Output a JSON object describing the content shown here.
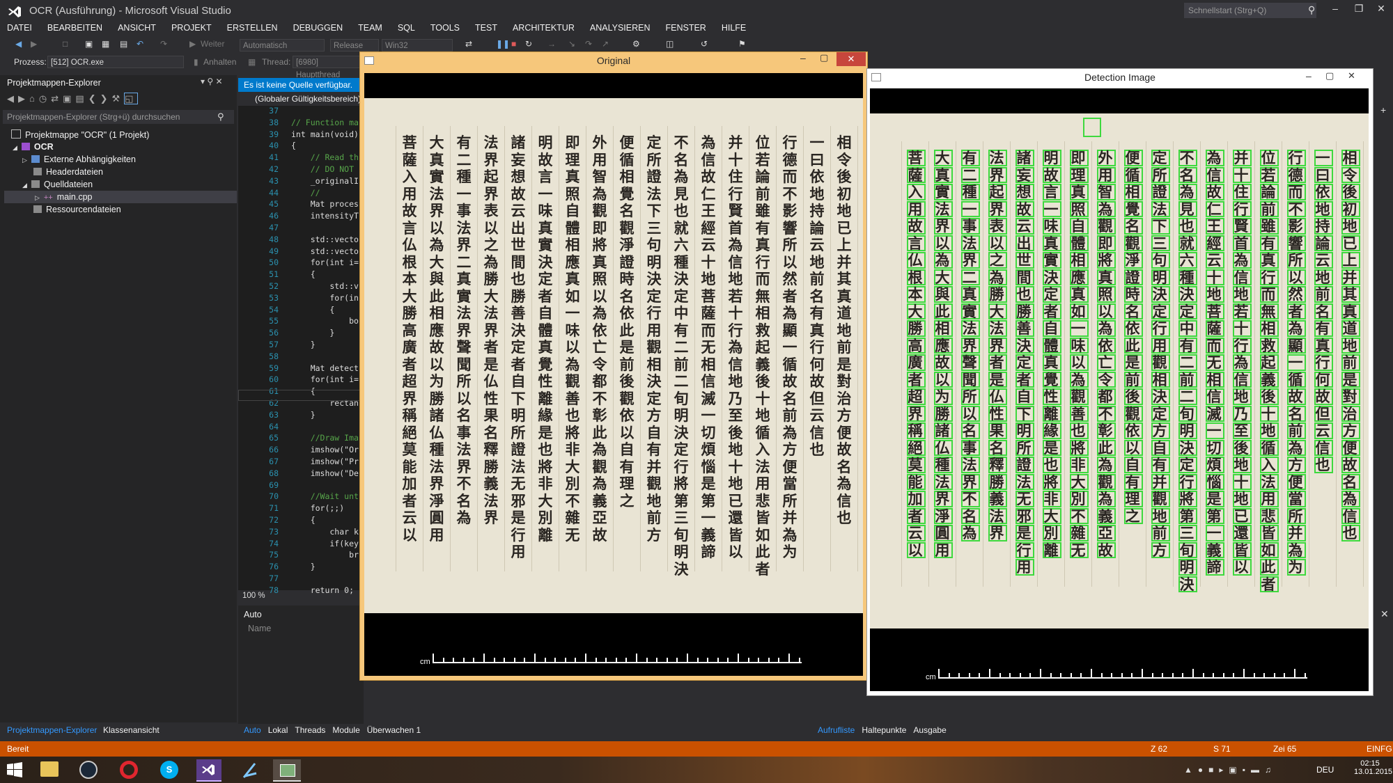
{
  "app": {
    "title": "OCR (Ausführung) - Microsoft Visual Studio",
    "quicklaunch_placeholder": "Schnellstart (Strg+Q)",
    "window_controls": [
      "minimize-icon",
      "restore-icon",
      "close-icon"
    ]
  },
  "menu": [
    "DATEI",
    "BEARBEITEN",
    "ANSICHT",
    "PROJEKT",
    "ERSTELLEN",
    "DEBUGGEN",
    "TEAM",
    "SQL",
    "TOOLS",
    "TEST",
    "ARCHITEKTUR",
    "ANALYSIEREN",
    "FENSTER",
    "HILFE"
  ],
  "toolbar": {
    "continue_label": "Weiter",
    "config_auto": "Automatisch",
    "config_build": "Release",
    "config_platform": "Win32",
    "process_label": "Prozess:",
    "process_value": "[512] OCR.exe",
    "suspend_label": "Anhalten",
    "thread_label": "Thread:",
    "thread_value": "[6980] Hauptthread"
  },
  "solution_explorer": {
    "title": "Projektmappen-Explorer",
    "search_placeholder": "Projektmappen-Explorer (Strg+ü) durchsuchen",
    "items": [
      {
        "label": "Projektmappe \"OCR\" (1 Projekt)",
        "level": 0
      },
      {
        "label": "OCR",
        "level": 1
      },
      {
        "label": "Externe Abhängigkeiten",
        "level": 2
      },
      {
        "label": "Headerdateien",
        "level": 2
      },
      {
        "label": "Quelldateien",
        "level": 2
      },
      {
        "label": "main.cpp",
        "level": 3
      },
      {
        "label": "Ressourcendateien",
        "level": 2
      }
    ],
    "tabs": [
      "Projektmappen-Explorer",
      "Klassenansicht"
    ]
  },
  "editor": {
    "tab_label": "Es ist keine Quelle verfügbar.",
    "scope": "(Globaler Gültigkeitsbereich)",
    "lines": [
      {
        "n": "37",
        "t": ""
      },
      {
        "n": "38",
        "t": "// Function ma"
      },
      {
        "n": "39",
        "t": "int main(void)"
      },
      {
        "n": "40",
        "t": "{"
      },
      {
        "n": "41",
        "t": "    // Read th"
      },
      {
        "n": "42",
        "t": "    // DO NOT"
      },
      {
        "n": "43",
        "t": "    _originalI"
      },
      {
        "n": "44",
        "t": "    //"
      },
      {
        "n": "45",
        "t": "    Mat proces"
      },
      {
        "n": "46",
        "t": "    intensityT"
      },
      {
        "n": "47",
        "t": ""
      },
      {
        "n": "48",
        "t": "    std::vecto"
      },
      {
        "n": "49",
        "t": "    std::vecto"
      },
      {
        "n": "50",
        "t": "    for(int i="
      },
      {
        "n": "51",
        "t": "    {"
      },
      {
        "n": "52",
        "t": "        std::v"
      },
      {
        "n": "53",
        "t": "        for(in"
      },
      {
        "n": "54",
        "t": "        {"
      },
      {
        "n": "55",
        "t": "            bo"
      },
      {
        "n": "56",
        "t": "        }"
      },
      {
        "n": "57",
        "t": "    }"
      },
      {
        "n": "58",
        "t": ""
      },
      {
        "n": "59",
        "t": "    Mat detect"
      },
      {
        "n": "60",
        "t": "    for(int i="
      },
      {
        "n": "61",
        "t": "    {"
      },
      {
        "n": "62",
        "t": "        rectan"
      },
      {
        "n": "63",
        "t": "    }"
      },
      {
        "n": "64",
        "t": ""
      },
      {
        "n": "65",
        "t": "    //Draw Ima"
      },
      {
        "n": "66",
        "t": "    imshow(\"Or"
      },
      {
        "n": "67",
        "t": "    imshow(\"Pr"
      },
      {
        "n": "68",
        "t": "    imshow(\"De"
      },
      {
        "n": "69",
        "t": ""
      },
      {
        "n": "70",
        "t": "    //Wait unt"
      },
      {
        "n": "71",
        "t": "    for(;;)"
      },
      {
        "n": "72",
        "t": "    {"
      },
      {
        "n": "73",
        "t": "        char k"
      },
      {
        "n": "74",
        "t": "        if(key"
      },
      {
        "n": "75",
        "t": "            br"
      },
      {
        "n": "76",
        "t": "    }"
      },
      {
        "n": "77",
        "t": ""
      },
      {
        "n": "78",
        "t": "    return 0;"
      }
    ],
    "zoom": "100 %"
  },
  "auto_panel": {
    "title": "Auto",
    "column_name": "Name",
    "tabs": [
      "Auto",
      "Lokal",
      "Threads",
      "Module",
      "Überwachen 1"
    ]
  },
  "right_tabs": [
    "Aufrufliste",
    "Haltepunkte",
    "Ausgabe"
  ],
  "statusbar": {
    "ready": "Bereit",
    "line": "Z 62",
    "col": "S 71",
    "char": "Zei 65",
    "mode": "EINFG"
  },
  "taskbar": {
    "apps": [
      "windows-start-icon",
      "file-explorer-icon",
      "steam-icon",
      "opera-icon",
      "skype-icon",
      "visual-studio-icon",
      "ink-icon",
      "ocr-app-icon"
    ],
    "lang": "DEU",
    "time": "02:15",
    "date": "13.01.2015"
  },
  "windows": {
    "original_title": "Original",
    "detection_title": "Detection Image",
    "ruler_label": "cm"
  },
  "manuscript_columns": [
    "相令後初地已上并其真道地前是對治方便故名為信也",
    "一曰依地持論云地前名有真行何故但云信也",
    "行德而不影響所以然者為顯一循故名前為方便當所并為为",
    "位若論前雖有真行而無相救起義後十地循入法用悲皆如此者",
    "并十住行賢首為信地若十行為信地乃至後地十地已還皆以",
    "為信故仁王經云十地菩薩而无相信滅一切煩惱是第一義諦",
    "不名為見也就六種決定中有二前二旬明決定行將第三旬明決",
    "定所證法下三句明決定行用觀相決定方自有并觀地前方",
    "便循相覺名觀淨證時名依此是前後觀依以自有理之",
    "外用智為觀即將真照以為依亡令都不彰此為觀為義亞故",
    "即理真照自體相應真如一味以為觀善也將非大別不雜无",
    "明故言一味真實決定者自體真覺性離緣是也將非大別離",
    "諸妄想故云出世間也勝善決定者自下明所證法无邪是行用",
    "法界起界表以之為勝大法界者是仏性果名釋勝義法界",
    "有二種一事法界二真實法界聲聞所以名事法界不名為",
    "大真實法界以為大與此相應故以为勝諸仏種法界淨圓用",
    "菩薩入用故言仏根本大勝高廣者超界稱絕莫能加者云以"
  ]
}
